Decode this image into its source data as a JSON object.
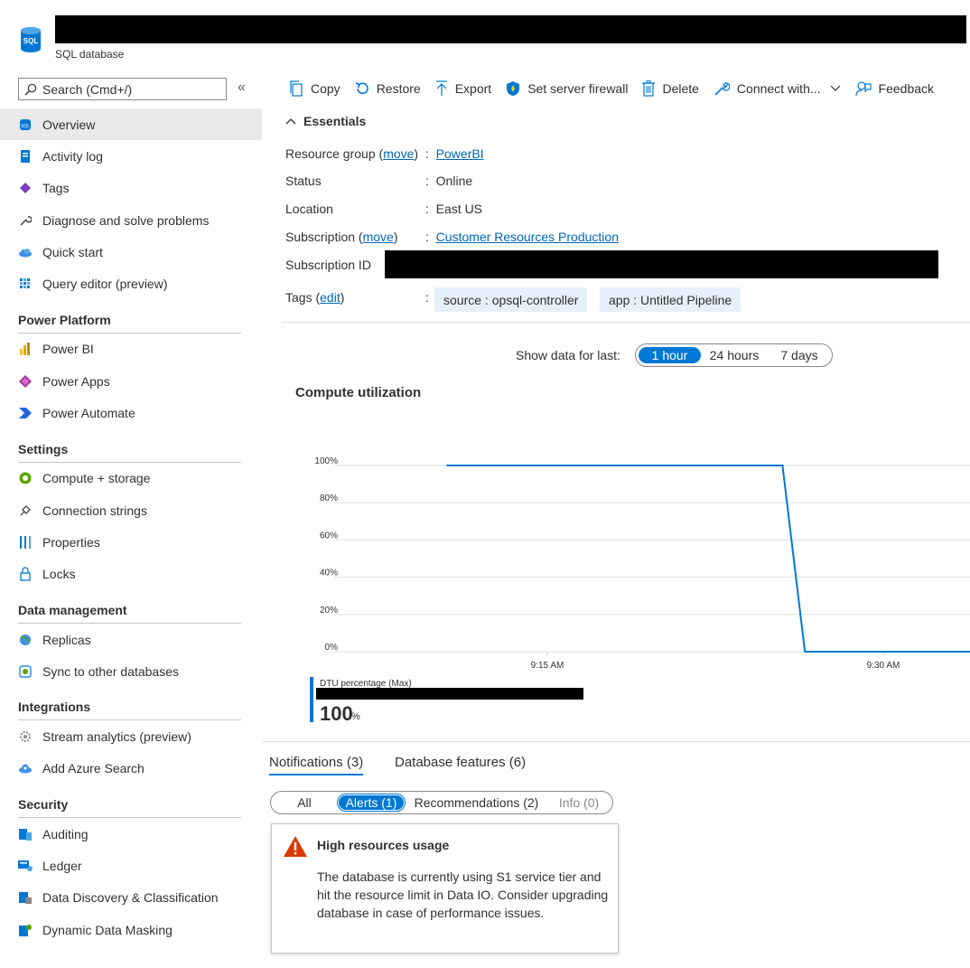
{
  "header": {
    "subtitle": "SQL database",
    "icon": "sql-database-icon"
  },
  "sidebar": {
    "search_placeholder": "Search (Cmd+/)",
    "collapse_icon": "«",
    "items": [
      {
        "label": "Overview",
        "icon": "sql-database-icon",
        "active": true
      },
      {
        "label": "Activity log",
        "icon": "activity-log-icon"
      },
      {
        "label": "Tags",
        "icon": "tag-icon"
      },
      {
        "label": "Diagnose and solve problems",
        "icon": "wrench-icon"
      },
      {
        "label": "Quick start",
        "icon": "cloud-icon"
      },
      {
        "label": "Query editor (preview)",
        "icon": "query-editor-icon"
      }
    ],
    "sections": [
      {
        "title": "Power Platform",
        "items": [
          {
            "label": "Power BI",
            "icon": "power-bi-icon"
          },
          {
            "label": "Power Apps",
            "icon": "power-apps-icon"
          },
          {
            "label": "Power Automate",
            "icon": "power-automate-icon"
          }
        ]
      },
      {
        "title": "Settings",
        "items": [
          {
            "label": "Compute + storage",
            "icon": "compute-icon"
          },
          {
            "label": "Connection strings",
            "icon": "plug-icon"
          },
          {
            "label": "Properties",
            "icon": "properties-icon"
          },
          {
            "label": "Locks",
            "icon": "lock-icon"
          }
        ]
      },
      {
        "title": "Data management",
        "items": [
          {
            "label": "Replicas",
            "icon": "globe-icon"
          },
          {
            "label": "Sync to other databases",
            "icon": "sync-icon"
          }
        ]
      },
      {
        "title": "Integrations",
        "items": [
          {
            "label": "Stream analytics (preview)",
            "icon": "gear-icon"
          },
          {
            "label": "Add Azure Search",
            "icon": "cloud-search-icon"
          }
        ]
      },
      {
        "title": "Security",
        "items": [
          {
            "label": "Auditing",
            "icon": "auditing-icon"
          },
          {
            "label": "Ledger",
            "icon": "ledger-icon"
          },
          {
            "label": "Data Discovery & Classification",
            "icon": "classification-icon"
          },
          {
            "label": "Dynamic Data Masking",
            "icon": "masking-icon"
          }
        ]
      }
    ]
  },
  "toolbar": {
    "copy": "Copy",
    "restore": "Restore",
    "export": "Export",
    "firewall": "Set server firewall",
    "delete": "Delete",
    "connect": "Connect with...",
    "feedback": "Feedback"
  },
  "essentials": {
    "title": "Essentials",
    "resource_group_label": "Resource group",
    "move": "move",
    "resource_group_value": "PowerBI",
    "status_label": "Status",
    "status_value": "Online",
    "location_label": "Location",
    "location_value": "East US",
    "subscription_label": "Subscription",
    "subscription_value": "Customer Resources Production",
    "subscription_id_label": "Subscription ID",
    "tags_label": "Tags",
    "edit": "edit",
    "tags": [
      "source : opsql-controller",
      "app : Untitled Pipeline"
    ],
    "colon": ":"
  },
  "range": {
    "label": "Show data for last:",
    "options": [
      "1 hour",
      "24 hours",
      "7 days"
    ],
    "selected": "1 hour"
  },
  "chart": {
    "title": "Compute utilization",
    "legend_name": "DTU percentage (Max)",
    "legend_value": "100",
    "legend_unit": "%"
  },
  "chart_data": {
    "type": "line",
    "title": "Compute utilization",
    "yticks": [
      "0%",
      "20%",
      "40%",
      "60%",
      "80%",
      "100%"
    ],
    "xticks": [
      "9:15 AM",
      "9:30 AM"
    ],
    "ylim": [
      0,
      100
    ],
    "series": [
      {
        "name": "DTU percentage (Max)",
        "x_minutes": [
          -4.5,
          10.5,
          11.5,
          20.5
        ],
        "values": [
          100,
          100,
          0,
          0
        ]
      }
    ]
  },
  "notifications": {
    "tabs": [
      "Notifications (3)",
      "Database features (6)"
    ],
    "filters": [
      "All",
      "Alerts (1)",
      "Recommendations (2)",
      "Info (0)"
    ],
    "card_title": "High resources usage",
    "card_body": "The database is currently using S1 service tier and hit the resource limit in Data IO. Consider upgrading database in case of performance issues."
  },
  "colors": {
    "accent": "#0078d4",
    "warning": "#d83b01"
  }
}
